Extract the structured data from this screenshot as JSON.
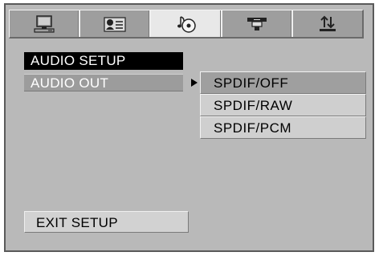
{
  "tabs": [
    {
      "icon": "monitor-icon",
      "active": false
    },
    {
      "icon": "language-icon",
      "active": false
    },
    {
      "icon": "music-disc-icon",
      "active": true
    },
    {
      "icon": "video-camera-icon",
      "active": false
    },
    {
      "icon": "sort-arrows-icon",
      "active": false
    }
  ],
  "menu": {
    "title": "AUDIO SETUP",
    "audio_out_label": "AUDIO OUT",
    "exit_label": "EXIT SETUP"
  },
  "submenu": {
    "options": [
      "SPDIF/OFF",
      "SPDIF/RAW",
      "SPDIF/PCM"
    ],
    "selected_index": 0
  },
  "colors": {
    "panel": "#b9b9b9",
    "active_tab": "#e8e8e8",
    "highlight": "#000000"
  }
}
